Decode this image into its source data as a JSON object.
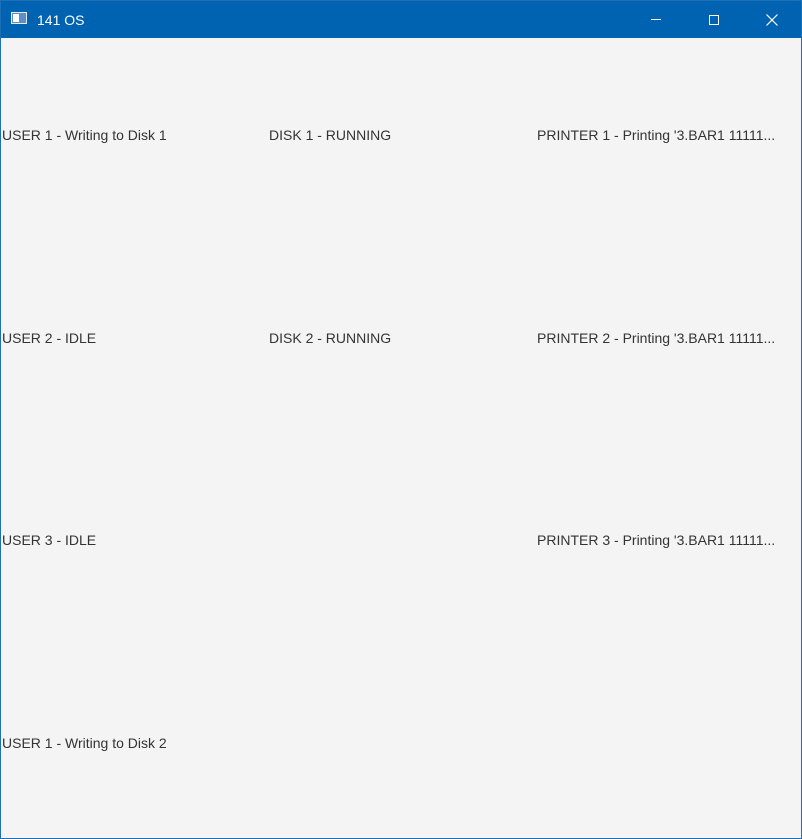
{
  "window": {
    "title": "141 OS",
    "icon": "app-window-icon"
  },
  "controls": {
    "minimize": "minimize-icon",
    "maximize": "maximize-icon",
    "close": "close-icon"
  },
  "users": [
    {
      "status": "USER 1 - Writing to Disk 1"
    },
    {
      "status": "USER 2 - IDLE"
    },
    {
      "status": "USER 3 - IDLE"
    },
    {
      "status": "USER 1 - Writing to Disk 2"
    }
  ],
  "disks": [
    {
      "status": "DISK 1 - RUNNING"
    },
    {
      "status": "DISK 2 - RUNNING"
    }
  ],
  "printers": [
    {
      "status": "PRINTER 1 - Printing  '3.BAR1 11111..."
    },
    {
      "status": "PRINTER 2 - Printing  '3.BAR1 11111..."
    },
    {
      "status": "PRINTER 3 - Printing  '3.BAR1 11111..."
    }
  ],
  "colors": {
    "titlebar": "#0063b1",
    "background": "#f4f4f4",
    "text": "#333333"
  }
}
